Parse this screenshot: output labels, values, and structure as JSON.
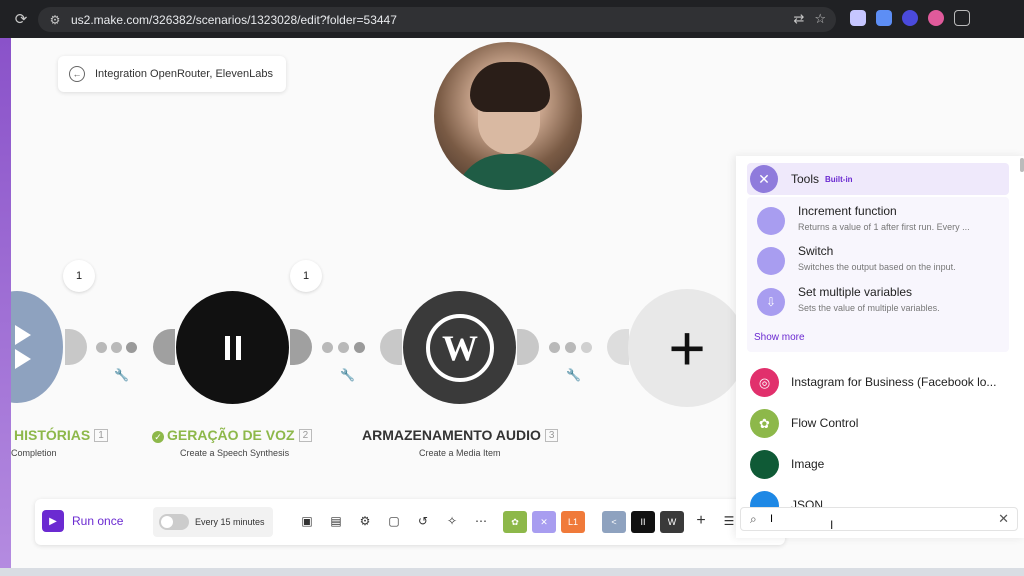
{
  "browser": {
    "url": "us2.make.com/326382/scenarios/1323028/edit?folder=53447"
  },
  "breadcrumb": {
    "title": "Integration OpenRouter, ElevenLabs"
  },
  "canvas": {
    "nodes": [
      {
        "title": "HISTÓRIAS",
        "number": "1",
        "subtitle": "Completion",
        "color": "#8ea2bf",
        "title_color": "#8db84a"
      },
      {
        "title": "GERAÇÃO DE VOZ",
        "number": "2",
        "subtitle": "Create a Speech Synthesis",
        "color": "#111111",
        "title_color": "#8db84a"
      },
      {
        "title": "ARMAZENAMENTO AUDIO",
        "number": "3",
        "subtitle": "Create a Media Item",
        "color": "#3a3a3a",
        "title_color": "#333333"
      }
    ],
    "badges": [
      "1",
      "1"
    ],
    "add_icon": "plus-icon"
  },
  "toolbar": {
    "run_once": "Run once",
    "schedule": "Every 15 minutes",
    "module_labels": [
      "",
      "",
      "L1",
      "",
      "II",
      ""
    ]
  },
  "panel": {
    "tools": {
      "name": "Tools",
      "badge": "Built-in"
    },
    "tool_items": [
      {
        "title": "Increment function",
        "desc": "Returns a value of 1 after first run. Every ..."
      },
      {
        "title": "Switch",
        "desc": "Switches the output based on the input."
      },
      {
        "title": "Set multiple variables",
        "desc": "Sets the value of multiple variables."
      }
    ],
    "show_more": "Show more",
    "apps": [
      {
        "title": "Instagram for Business (Facebook lo...",
        "color": "#e1306c"
      },
      {
        "title": "Flow Control",
        "color": "#8db84a"
      },
      {
        "title": "Image",
        "color": "#0f5a36"
      },
      {
        "title": "JSON",
        "color": "#1e88e5"
      }
    ],
    "search": {
      "value": "I",
      "placeholder": ""
    }
  }
}
